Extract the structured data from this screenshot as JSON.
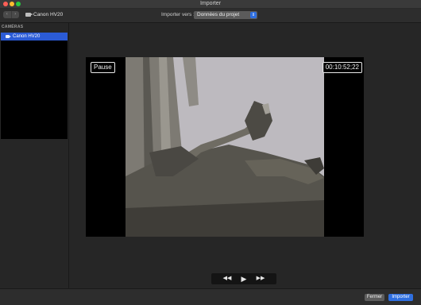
{
  "window": {
    "title": "Importer"
  },
  "toolbar": {
    "nav_back_label": "‹",
    "nav_forward_label": "›",
    "device_name": "Canon HV20",
    "import_to_label": "Importer vers :",
    "destination_value": "Données du projet",
    "destination_arrow": "⇕"
  },
  "sidebar": {
    "section_title": "CAMÉRAS",
    "items": [
      {
        "label": "Canon HV20",
        "selected": true
      }
    ]
  },
  "viewer": {
    "pause_label": "Pause",
    "timecode": "00:10:52;22"
  },
  "transport": {
    "rewind_label": "◀◀",
    "play_label": "▶",
    "forward_label": "▶▶"
  },
  "footer": {
    "close_label": "Fermer",
    "import_label": "Importer"
  },
  "colors": {
    "accent": "#2f6fe0",
    "selection": "#2b5bd6"
  }
}
